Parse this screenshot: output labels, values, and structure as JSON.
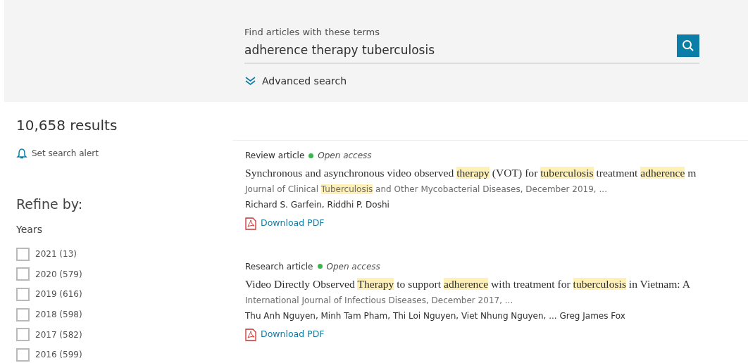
{
  "search": {
    "label": "Find articles with these terms",
    "value": "adherence therapy tuberculosis",
    "advanced_link": "Advanced search"
  },
  "results_count": "10,658 results",
  "alert_link": "Set search alert",
  "refine": {
    "title": "Refine by:",
    "group": "Years",
    "options": [
      {
        "label": "2021 (13)",
        "checked": false
      },
      {
        "label": "2020 (579)",
        "checked": false
      },
      {
        "label": "2019 (616)",
        "checked": false
      },
      {
        "label": "2018 (598)",
        "checked": false
      },
      {
        "label": "2017 (582)",
        "checked": false
      },
      {
        "label": "2016 (599)",
        "checked": false
      }
    ]
  },
  "results": [
    {
      "type": "Review article",
      "open_access": true,
      "access_label": "Open access",
      "title": [
        {
          "text": "Synchronous and asynchronous video observed ",
          "highlighted": false
        },
        {
          "text": "therapy",
          "highlighted": true
        },
        {
          "text": " (VOT) for ",
          "highlighted": false
        },
        {
          "text": "tuberculosis",
          "highlighted": true
        },
        {
          "text": " treatment ",
          "highlighted": false
        },
        {
          "text": "adherence",
          "highlighted": true
        },
        {
          "text": " m",
          "highlighted": false
        }
      ],
      "source": [
        {
          "text": "Journal of Clinical ",
          "highlighted": false
        },
        {
          "text": "Tuberculosis",
          "highlighted": true
        },
        {
          "text": " and Other Mycobacterial Diseases, December 2019, ...",
          "highlighted": false
        }
      ],
      "authors": "Richard S. Garfein, Riddhi P. Doshi",
      "download": "Download PDF"
    },
    {
      "type": "Research article",
      "open_access": true,
      "access_label": "Open access",
      "title": [
        {
          "text": "Video Directly Observed ",
          "highlighted": false
        },
        {
          "text": "Therapy",
          "highlighted": true
        },
        {
          "text": " to support ",
          "highlighted": false
        },
        {
          "text": "adherence",
          "highlighted": true
        },
        {
          "text": " with treatment for ",
          "highlighted": false
        },
        {
          "text": "tuberculosis",
          "highlighted": true
        },
        {
          "text": " in Vietnam: A",
          "highlighted": false
        }
      ],
      "source": [
        {
          "text": "International Journal of Infectious Diseases, December 2017, ...",
          "highlighted": false
        }
      ],
      "authors": "Thu Anh Nguyen, Minh Tam Pham, Thi Loi Nguyen, Viet Nhung Nguyen, ... Greg James Fox",
      "download": "Download PDF"
    }
  ]
}
